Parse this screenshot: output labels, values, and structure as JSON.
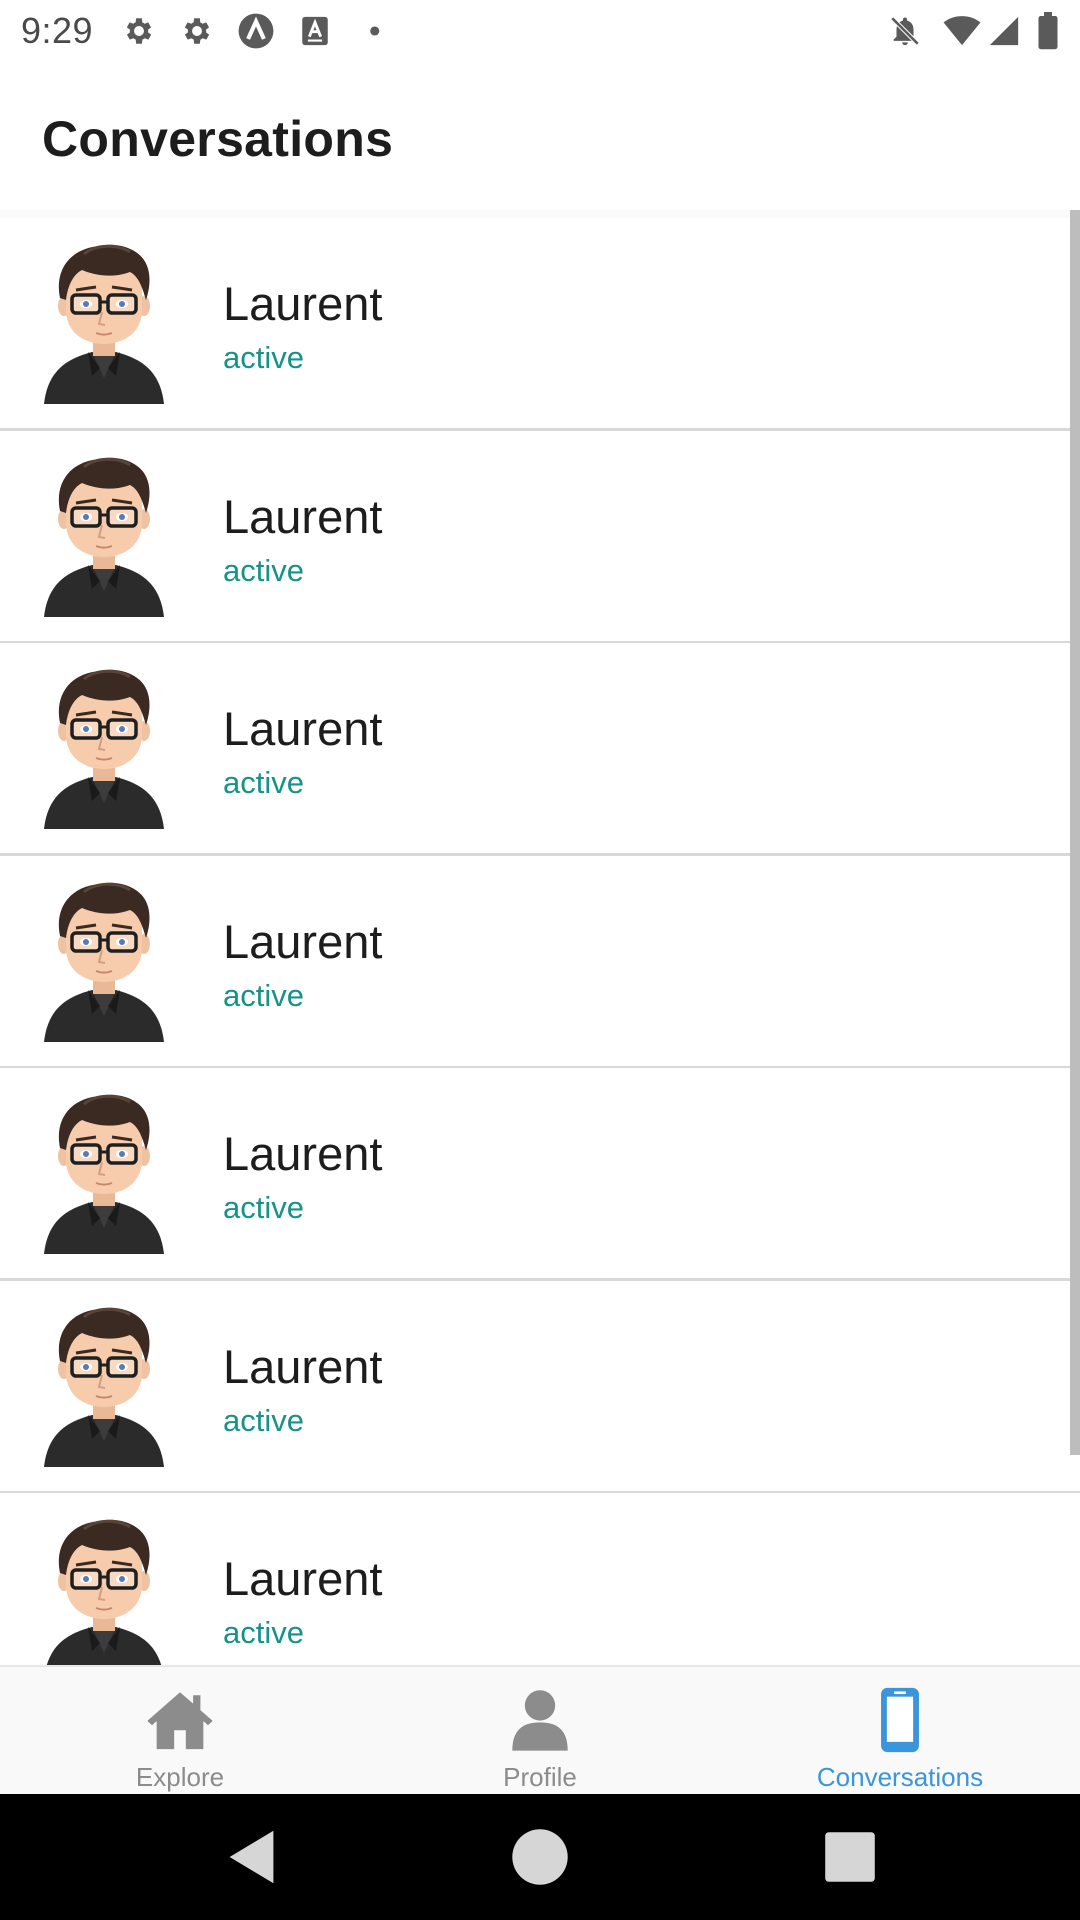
{
  "status_bar": {
    "time": "9:29",
    "left_icons": [
      "gear-icon",
      "gear-icon",
      "app-a-icon",
      "text-a-icon",
      "dot-icon"
    ],
    "right_icons": [
      "notifications-off-icon",
      "wifi-icon",
      "signal-icon",
      "battery-icon"
    ]
  },
  "header": {
    "title": "Conversations"
  },
  "conversations": [
    {
      "name": "Laurent",
      "status": "active"
    },
    {
      "name": "Laurent",
      "status": "active"
    },
    {
      "name": "Laurent",
      "status": "active"
    },
    {
      "name": "Laurent",
      "status": "active"
    },
    {
      "name": "Laurent",
      "status": "active"
    },
    {
      "name": "Laurent",
      "status": "active"
    },
    {
      "name": "Laurent",
      "status": "active"
    }
  ],
  "tabs": [
    {
      "label": "Explore",
      "icon": "home-icon",
      "active": false
    },
    {
      "label": "Profile",
      "icon": "person-icon",
      "active": false
    },
    {
      "label": "Conversations",
      "icon": "phone-icon",
      "active": true
    }
  ],
  "colors": {
    "accent": "#3b95db",
    "status_active": "#169389",
    "tab_inactive": "#8c8c8c"
  },
  "nav_bar": {
    "buttons": [
      "back-icon",
      "home-circle-icon",
      "recents-icon"
    ]
  }
}
